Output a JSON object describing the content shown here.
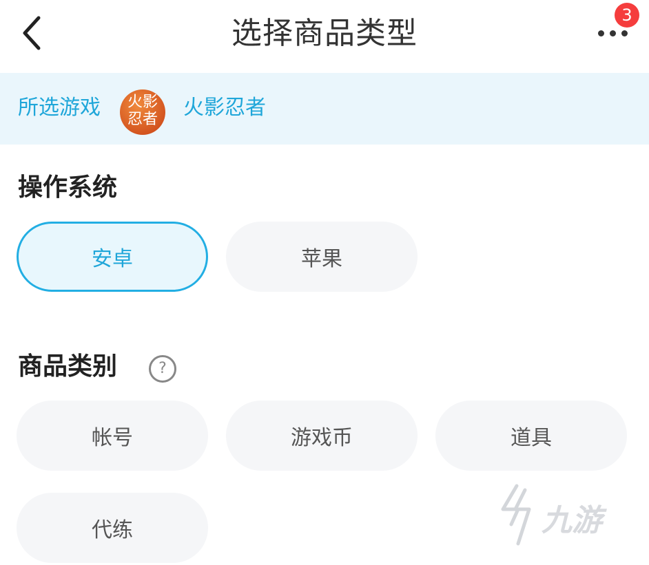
{
  "header": {
    "title": "选择商品类型",
    "badge_count": "3"
  },
  "game": {
    "label": "所选游戏",
    "logo_line1": "火影",
    "logo_line2": "忍者",
    "name": "火影忍者"
  },
  "os_section": {
    "title": "操作系统",
    "options": [
      "安卓",
      "苹果"
    ],
    "selected": "安卓"
  },
  "category_section": {
    "title": "商品类别",
    "help": "?",
    "options": [
      "帐号",
      "游戏币",
      "道具",
      "代练"
    ]
  },
  "watermark": {
    "text": "九游"
  },
  "colors": {
    "accent": "#1fa6d9",
    "badge": "#f53d3d",
    "game_bar_bg": "#eaf6fc",
    "pill_bg": "#f5f6f8"
  }
}
